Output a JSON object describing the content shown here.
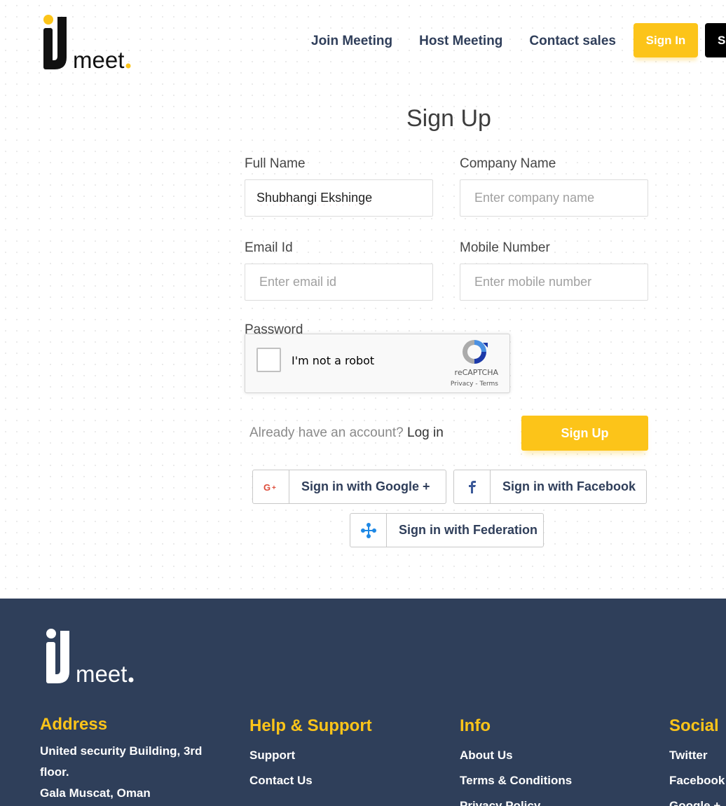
{
  "header": {
    "logo_text": "IJmeet.",
    "nav": [
      "Join Meeting",
      "Host Meeting",
      "Contact sales"
    ],
    "signin_label": "Sign In",
    "signup_label": "S"
  },
  "form": {
    "title": "Sign Up",
    "full_name": {
      "label": "Full Name",
      "value": "Shubhangi Ekshinge"
    },
    "company": {
      "label": "Company Name",
      "placeholder": "Enter company name"
    },
    "email": {
      "label": "Email Id",
      "placeholder": "Enter email id"
    },
    "mobile": {
      "label": "Mobile Number",
      "placeholder": "Enter mobile number"
    },
    "password": {
      "label": "Password"
    },
    "recaptcha": {
      "text": "I'm not a robot",
      "brand": "reCAPTCHA",
      "privacy": "Privacy",
      "sep": " - ",
      "terms": "Terms"
    },
    "already_text": "Already have an account?",
    "login_link": "Log in",
    "submit_label": "Sign Up"
  },
  "social": {
    "google": "Sign in with Google +",
    "facebook": "Sign in with Facebook",
    "federation": "Sign in with Federation"
  },
  "footer": {
    "address": {
      "heading": "Address",
      "line1": "United security Building, 3rd",
      "line2": "floor.",
      "line3": "Gala Muscat, Oman"
    },
    "help": {
      "heading": "Help & Support",
      "items": [
        "Support",
        "Contact Us"
      ]
    },
    "info": {
      "heading": "Info",
      "items": [
        "About Us",
        "Terms & Conditions",
        "Privacy Policy"
      ]
    },
    "social": {
      "heading": "Social",
      "items": [
        "Twitter",
        "Facebook",
        "Google +"
      ]
    }
  },
  "colors": {
    "accent": "#fcc419",
    "navy": "#2f3f5a",
    "nav_text": "#2f3e5a"
  }
}
